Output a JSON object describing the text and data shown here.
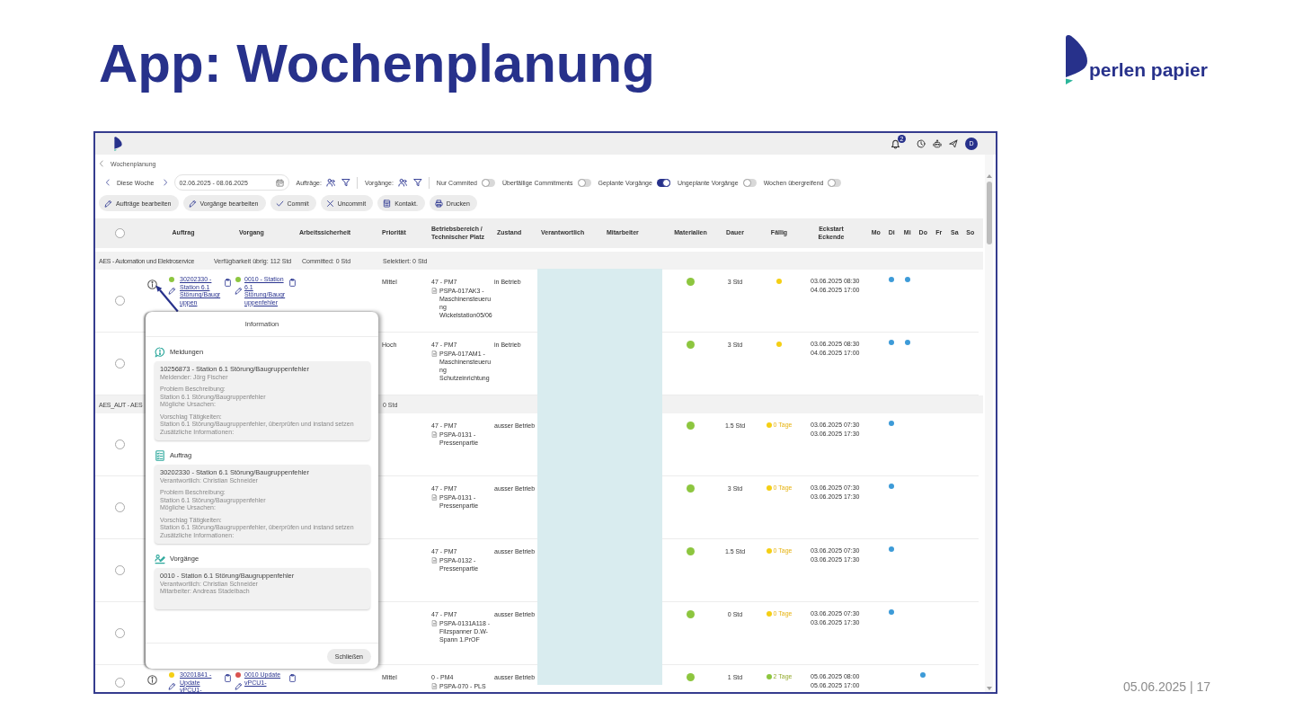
{
  "slide": {
    "title": "App: Wochenplanung",
    "logo": "perlen papier",
    "footer": "05.06.2025 | 17"
  },
  "top_bar": {
    "badge": "2",
    "avatar": "D"
  },
  "breadcrumb": "Wochenplanung",
  "toolbar": {
    "week": "Diese Woche",
    "date_range": "02.06.2025 - 08.06.2025",
    "filters": [
      {
        "label": "Aufträge:"
      },
      {
        "label": "Vorgänge:"
      }
    ],
    "toggles": [
      {
        "label": "Nur Commited",
        "on": false
      },
      {
        "label": "Überfällige Commitments",
        "on": false
      },
      {
        "label": "Geplante Vorgänge",
        "on": true
      },
      {
        "label": "Ungeplante Vorgänge",
        "on": false
      },
      {
        "label": "Wochen übergreifend",
        "on": false
      }
    ]
  },
  "actions": [
    {
      "label": "Aufträge bearbeiten",
      "kind": "edit"
    },
    {
      "label": "Vorgänge bearbeiten",
      "kind": "edit"
    },
    {
      "label": "Commit",
      "kind": "commit"
    },
    {
      "label": "Uncommit",
      "kind": "uncommit"
    },
    {
      "label": "Kontakt.",
      "kind": "sheet"
    },
    {
      "label": "Drucken",
      "kind": "print"
    }
  ],
  "table": {
    "select_all": {
      "checked": false
    },
    "columns": [
      "Auftrag",
      "Vorgang",
      "Arbeitssicherheit",
      "Priorität",
      "Betriebsbereich /\nTechnischer Platz",
      "Zustand",
      "Verantwortlich",
      "Mitarbeiter",
      "Materialien",
      "Dauer",
      "Fällig",
      "Eckstart\nEckende"
    ],
    "days": [
      "Mo",
      "Di",
      "Mi",
      "Do",
      "Fr",
      "Sa",
      "So"
    ],
    "rows": [
      {
        "kind": "group",
        "label": "AES - Automation und Elektroservice",
        "available": "Verfügbarkeit übrig: 112 Std",
        "committed": "Committed: 0 Std",
        "selection": "Selektiert: 0 Std"
      },
      {
        "kind": "order",
        "selected": false,
        "info": true,
        "order": {
          "color": "#8dc63f",
          "text": "30202330 - Station 6.1 Störung/Baugruppen"
        },
        "operation": {
          "color": "#8dc63f",
          "text": "0010 - Station 6.1 Störung/Baugruppenfehler"
        },
        "priority": "Mittel",
        "area": "47 - PM7",
        "place": "PSPA-017AK3 - Maschinensteuerung Wickelstation05/06",
        "state": "in Betrieb",
        "materials": {
          "color": "#8dc63f"
        },
        "duration": "3 Std",
        "due": {
          "color": "#f5cf14"
        },
        "start": "03.06.2025 08:30",
        "end": "04.06.2025 17:00",
        "days": [
          false,
          true,
          true,
          false,
          false,
          false,
          false
        ]
      },
      {
        "kind": "order",
        "selected": false,
        "priority": "Hoch",
        "area": "47 - PM7",
        "place": "PSPA-017AM1 - Maschinensteuerung Schutzeinrichtung",
        "state": "in Betrieb",
        "materials": {
          "color": "#8dc63f"
        },
        "duration": "3 Std",
        "due": {
          "color": "#f5cf14"
        },
        "start": "03.06.2025 08:30",
        "end": "04.06.2025 17:00",
        "days": [
          false,
          true,
          true,
          false,
          false,
          false,
          false
        ]
      },
      {
        "kind": "group",
        "label": "AES_AUT - AES",
        "selection": "0 Std"
      },
      {
        "kind": "order",
        "selected": false,
        "area": "47 - PM7",
        "place": "PSPA-0131 - Pressenpartie",
        "state": "ausser Betrieb",
        "materials": {
          "color": "#8dc63f"
        },
        "duration": "1.5 Std",
        "due": {
          "color": "#f5cf14",
          "text": "0 Tage"
        },
        "start": "03.06.2025 07:30",
        "end": "03.06.2025 17:30",
        "days": [
          false,
          true,
          false,
          false,
          false,
          false,
          false
        ]
      },
      {
        "kind": "order",
        "selected": false,
        "area": "47 - PM7",
        "place": "PSPA-0131 - Pressenpartie",
        "state": "ausser Betrieb",
        "materials": {
          "color": "#8dc63f"
        },
        "duration": "3 Std",
        "due": {
          "color": "#f5cf14",
          "text": "0 Tage"
        },
        "start": "03.06.2025 07:30",
        "end": "03.06.2025 17:30",
        "days": [
          false,
          true,
          false,
          false,
          false,
          false,
          false
        ]
      },
      {
        "kind": "order",
        "selected": false,
        "area": "47 - PM7",
        "place": "PSPA-0132 - Pressenpartie",
        "state": "ausser Betrieb",
        "materials": {
          "color": "#8dc63f"
        },
        "duration": "1.5 Std",
        "due": {
          "color": "#f5cf14",
          "text": "0 Tage"
        },
        "start": "03.06.2025 07:30",
        "end": "03.06.2025 17:30",
        "days": [
          false,
          true,
          false,
          false,
          false,
          false,
          false
        ]
      },
      {
        "kind": "order",
        "selected": false,
        "area": "47 - PM7",
        "place": "PSPA-0131A118 - Filzspanner D.W-Spann 1.PrOF",
        "state": "ausser Betrieb",
        "materials": {
          "color": "#8dc63f"
        },
        "duration": "0 Std",
        "due": {
          "color": "#f5cf14",
          "text": "0 Tage"
        },
        "start": "03.06.2025 07:30",
        "end": "03.06.2025 17:30",
        "days": [
          false,
          true,
          false,
          false,
          false,
          false,
          false
        ]
      },
      {
        "kind": "order",
        "selected": false,
        "info": true,
        "order": {
          "color": "#f5cf14",
          "text": "30201841 - Update vPCU1-"
        },
        "operation": {
          "color": "#d9534f",
          "text": "0010 Update vPCU1-"
        },
        "priority": "Mittel",
        "area": "0 - PM4",
        "place": "PSPA-070 - PLS",
        "state": "ausser Betrieb",
        "materials": {
          "color": "#8dc63f"
        },
        "duration": "1 Std",
        "due": {
          "color": "#8dc63f",
          "text": "2 Tage"
        },
        "start": "05.06.2025 08:00",
        "end": "05.06.2025 17:00",
        "days": [
          false,
          false,
          false,
          true,
          false,
          false,
          false
        ]
      }
    ]
  },
  "dialog": {
    "title": "Information",
    "sections": [
      {
        "kind": "notification",
        "heading": "Meldungen",
        "card": {
          "title": "10256873 - Station 6.1 Störung/Baugruppenfehler",
          "groups": [
            [
              "Meldender: Jörg Fischer"
            ],
            [
              "Problem Beschreibung:",
              "Station 6.1 Störung/Baugruppenfehler",
              "Mögliche Ursachen:"
            ],
            [
              "Vorschlag Tätigkeiten:",
              "Station 6.1 Störung/Baugruppenfehler, überprüfen und instand setzen",
              "Zusätzliche Informationen:"
            ]
          ]
        }
      },
      {
        "kind": "order",
        "heading": "Auftrag",
        "card": {
          "title": "30202330 - Station 6.1 Störung/Baugruppenfehler",
          "groups": [
            [
              "Verantwortlich: Christian Schneider"
            ],
            [
              "Problem Beschreibung:",
              "Station 6.1 Störung/Baugruppenfehler",
              "Mögliche Ursachen:"
            ],
            [
              "Vorschlag Tätigkeiten:",
              "Station 6.1 Störung/Baugruppenfehler, überprüfen und instand setzen",
              "Zusätzliche Informationen:"
            ]
          ]
        }
      },
      {
        "kind": "operation",
        "heading": "Vorgänge",
        "card": {
          "title": "0010 - Station 6.1 Störung/Baugruppenfehler",
          "groups": [
            [
              "Verantwortlich: Christian Schneider",
              "Mitarbeiter: Andreas Stadelbach"
            ]
          ]
        }
      }
    ],
    "close": "Schließen"
  }
}
